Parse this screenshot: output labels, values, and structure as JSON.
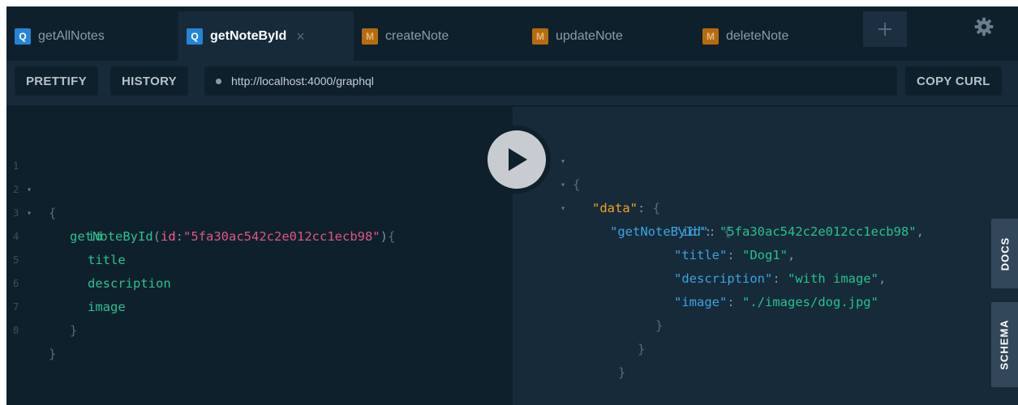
{
  "tabs": [
    {
      "badge": "Q",
      "label": "getAllNotes",
      "active": false
    },
    {
      "badge": "Q",
      "label": "getNoteById",
      "active": true
    },
    {
      "badge": "M",
      "label": "createNote",
      "active": false
    },
    {
      "badge": "M",
      "label": "updateNote",
      "active": false
    },
    {
      "badge": "M",
      "label": "deleteNote",
      "active": false
    }
  ],
  "close_glyph": "×",
  "add_glyph": "+",
  "toolbar": {
    "prettify": "PRETTIFY",
    "history": "HISTORY",
    "url": "http://localhost:4000/graphql",
    "copy_curl": "COPY CURL"
  },
  "query": {
    "line_numbers": [
      "1",
      "2",
      "3",
      "4",
      "5",
      "6",
      "7",
      "8"
    ],
    "open_brace": "{",
    "field": "getNoteById",
    "paren_open": "(",
    "arg_name": "id",
    "colon": ":",
    "arg_value": "\"5fa30ac542c2e012cc1ecb98\"",
    "paren_close": ")",
    "inner_brace": "{",
    "fields": [
      "id",
      "title",
      "description",
      "image"
    ],
    "inner_close": "}",
    "close_brace": "}"
  },
  "response": {
    "open": "{",
    "data_key": "\"data\"",
    "query_key": "\"getNoteById\"",
    "entries": [
      {
        "key": "\"id\"",
        "value": "\"5fa30ac542c2e012cc1ecb98\"",
        "comma": ","
      },
      {
        "key": "\"title\"",
        "value": "\"Dog1\"",
        "comma": ","
      },
      {
        "key": "\"description\"",
        "value": "\"with image\"",
        "comma": ","
      },
      {
        "key": "\"image\"",
        "value": "\"./images/dog.jpg\"",
        "comma": ""
      }
    ],
    "close": "}"
  },
  "side_tabs": {
    "docs": "DOCS",
    "schema": "SCHEMA"
  },
  "colors": {
    "background": "#0f202d",
    "panel": "#172a3a",
    "query_badge": "#2684d8",
    "mutation_badge": "#b56b10"
  }
}
